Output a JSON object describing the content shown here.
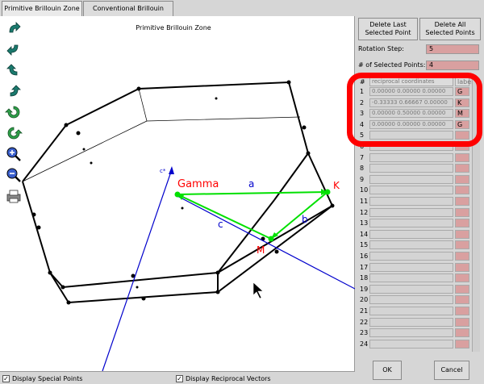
{
  "tabs": [
    {
      "label": "Primitive Brillouin Zone",
      "active": true
    },
    {
      "label": "Conventional Brillouin Zone",
      "active": false
    }
  ],
  "canvas": {
    "title": "Primitive Brillouin Zone",
    "axis_label": "c*",
    "labels": {
      "gamma": "Gamma",
      "k": "K",
      "m": "M",
      "a": "a",
      "b": "b",
      "c": "c"
    }
  },
  "toolbar": {
    "icons": [
      "rotate-up-icon",
      "rotate-down-icon",
      "rotate-left-icon",
      "rotate-right-icon",
      "rotate-cw-icon",
      "rotate-ccw-icon",
      "zoom-in-icon",
      "zoom-out-icon",
      "print-icon"
    ]
  },
  "bottom": {
    "special_points": "Display Special Points",
    "reciprocal_vectors": "Display Reciprocal Vectors",
    "special_checked": true,
    "vectors_checked": true
  },
  "panel": {
    "delete_last": "Delete Last Selected Point",
    "delete_all": "Delete All Selected Points",
    "rotation_label": "Rotation Step:",
    "rotation_value": "5",
    "selected_label": "# of Selected Points:",
    "selected_value": "4",
    "ok": "OK",
    "cancel": "Cancel"
  },
  "table": {
    "headers": {
      "num": "#",
      "coords": "reciprocal coordinates",
      "label": "label"
    },
    "rows": [
      {
        "n": "1",
        "coords": "0.00000   0.00000   0.00000",
        "label": "G"
      },
      {
        "n": "2",
        "coords": "-0.33333   0.66667   0.00000",
        "label": "K"
      },
      {
        "n": "3",
        "coords": "0.00000   0.50000   0.00000",
        "label": "M"
      },
      {
        "n": "4",
        "coords": "0.00000   0.00000   0.00000",
        "label": "G"
      },
      {
        "n": "5",
        "coords": "",
        "label": ""
      },
      {
        "n": "6",
        "coords": "",
        "label": ""
      },
      {
        "n": "7",
        "coords": "",
        "label": ""
      },
      {
        "n": "8",
        "coords": "",
        "label": ""
      },
      {
        "n": "9",
        "coords": "",
        "label": ""
      },
      {
        "n": "10",
        "coords": "",
        "label": ""
      },
      {
        "n": "11",
        "coords": "",
        "label": ""
      },
      {
        "n": "12",
        "coords": "",
        "label": ""
      },
      {
        "n": "13",
        "coords": "",
        "label": ""
      },
      {
        "n": "14",
        "coords": "",
        "label": ""
      },
      {
        "n": "15",
        "coords": "",
        "label": ""
      },
      {
        "n": "16",
        "coords": "",
        "label": ""
      },
      {
        "n": "17",
        "coords": "",
        "label": ""
      },
      {
        "n": "18",
        "coords": "",
        "label": ""
      },
      {
        "n": "19",
        "coords": "",
        "label": ""
      },
      {
        "n": "20",
        "coords": "",
        "label": ""
      },
      {
        "n": "21",
        "coords": "",
        "label": ""
      },
      {
        "n": "22",
        "coords": "",
        "label": ""
      },
      {
        "n": "23",
        "coords": "",
        "label": ""
      },
      {
        "n": "24",
        "coords": "",
        "label": ""
      }
    ]
  },
  "colors": {
    "vector": "#00e000",
    "axis": "#0000cc",
    "point_label": "#ff0000",
    "highlight": "#ff0000",
    "field": "#d9a0a0"
  }
}
